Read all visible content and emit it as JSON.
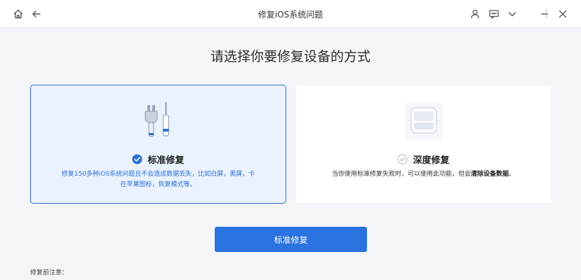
{
  "window": {
    "title": "修复iOS系统问题"
  },
  "main": {
    "heading": "请选择你要修复设备的方式",
    "cards": [
      {
        "title": "标准修复",
        "description": "修复150多种iOS系统问题且不会造成数据丢失，比如白屏，黑屏，卡在苹果图标，恢复模式等。",
        "selected": true
      },
      {
        "title": "深度修复",
        "description_prefix": "当你使用标准修复失败时，可以使用此功能，但会",
        "description_bold": "清除设备数据",
        "description_suffix": "。",
        "selected": false
      }
    ],
    "primary_button": "标准修复",
    "notes_label": "修复前注意："
  },
  "colors": {
    "accent": "#2a73e0",
    "selected_border": "#2f6fd4",
    "selected_bg": "#e9f2fd"
  },
  "icons": {
    "home": "home-icon",
    "back": "back-arrow-icon",
    "user": "user-icon",
    "feedback": "message-icon",
    "menu": "chevron-down-icon",
    "minimize": "minimize-icon",
    "close": "close-icon"
  }
}
